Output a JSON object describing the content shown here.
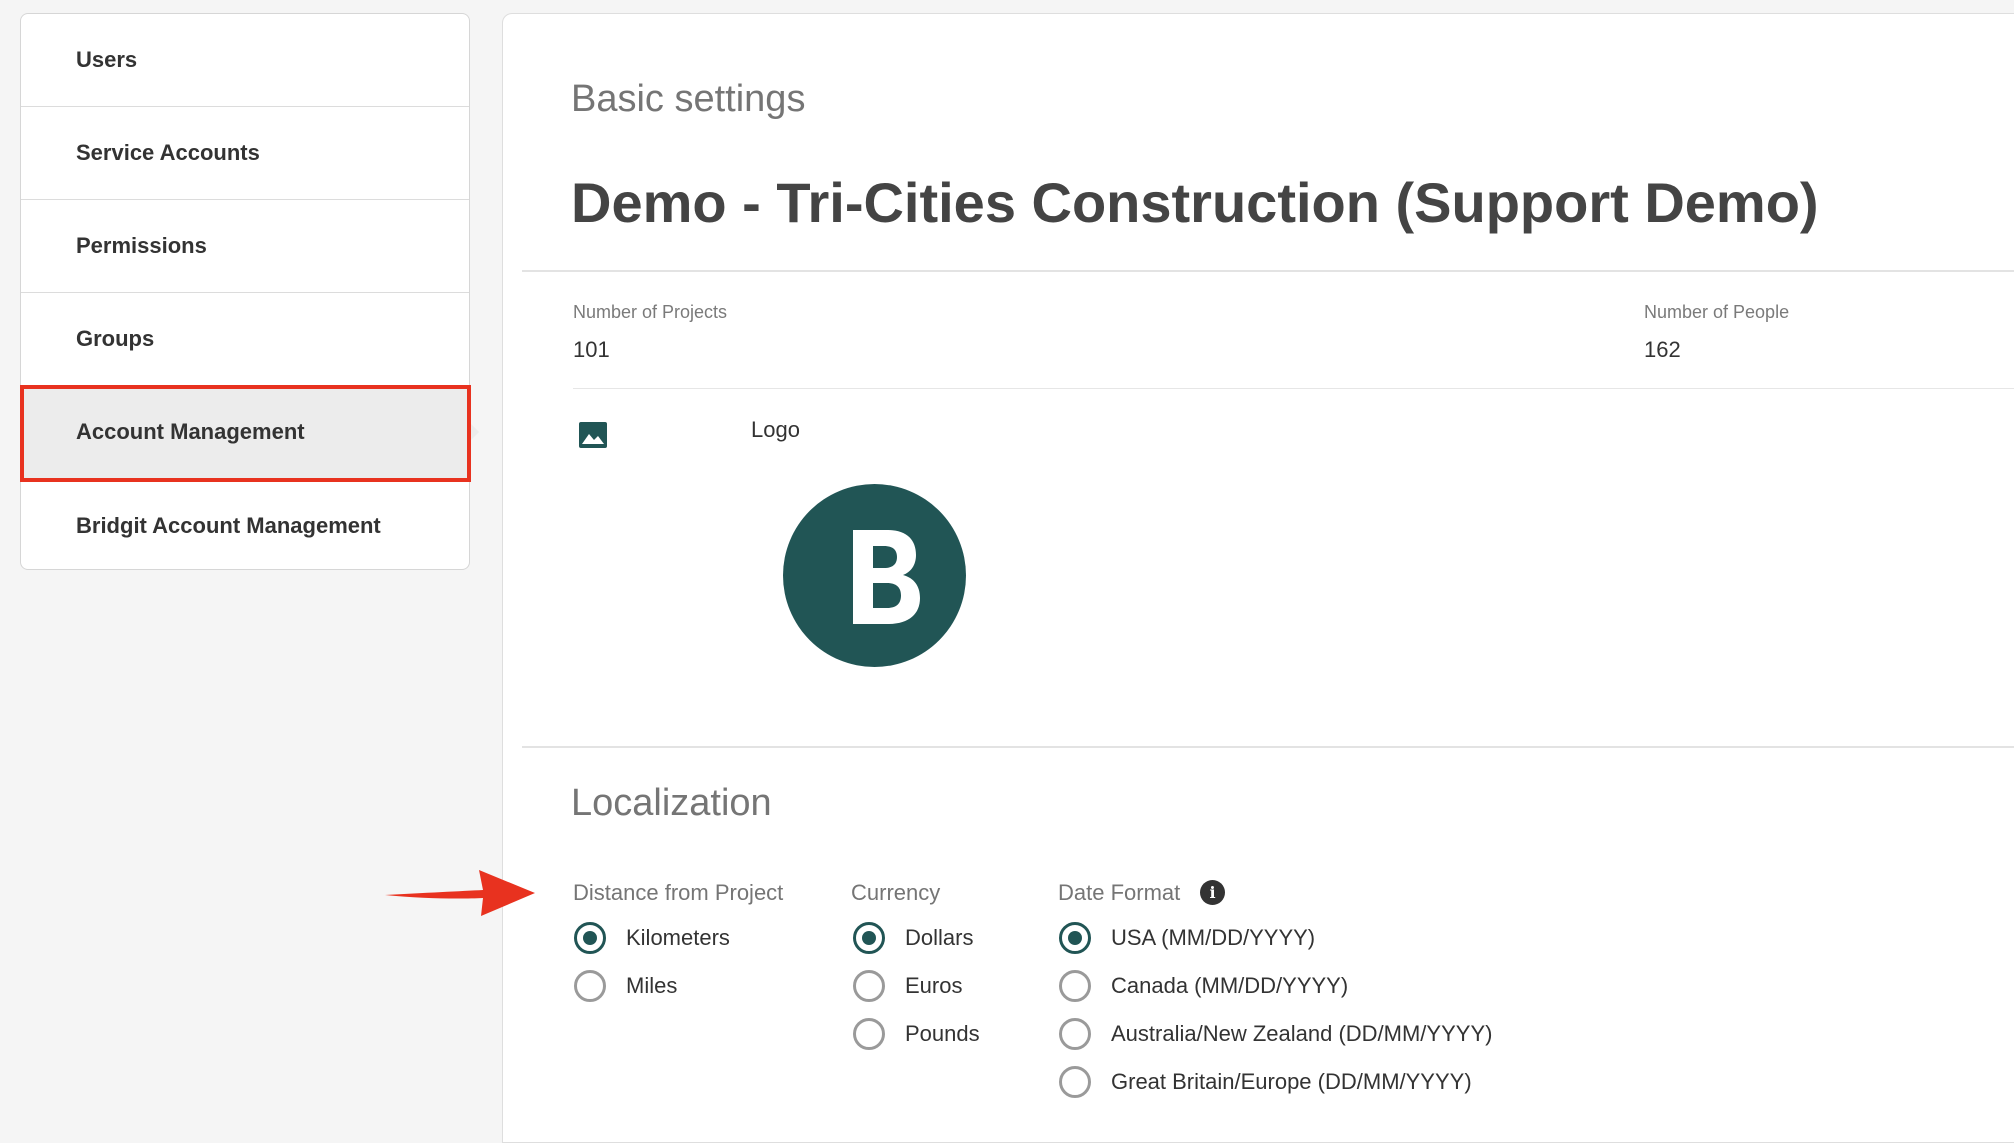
{
  "sidebar": {
    "items": [
      {
        "label": "Users"
      },
      {
        "label": "Service Accounts"
      },
      {
        "label": "Permissions"
      },
      {
        "label": "Groups"
      },
      {
        "label": "Account Management"
      },
      {
        "label": "Bridgit Account Management"
      }
    ],
    "active": "Account Management"
  },
  "basic": {
    "heading": "Basic settings",
    "account_name": "Demo - Tri-Cities Construction (Support Demo)",
    "projects_label": "Number of Projects",
    "projects_value": "101",
    "people_label": "Number of People",
    "people_value": "162",
    "logo_label": "Logo",
    "logo_letter": "B"
  },
  "localization": {
    "heading": "Localization",
    "distance": {
      "title": "Distance from Project",
      "options": [
        "Kilometers",
        "Miles"
      ],
      "selected": "Kilometers"
    },
    "currency": {
      "title": "Currency",
      "options": [
        "Dollars",
        "Euros",
        "Pounds"
      ],
      "selected": "Dollars"
    },
    "date_format": {
      "title": "Date Format",
      "info_glyph": "i",
      "options": [
        "USA (MM/DD/YYYY)",
        "Canada (MM/DD/YYYY)",
        "Australia/New Zealand (DD/MM/YYYY)",
        "Great Britain/Europe (DD/MM/YYYY)"
      ],
      "selected": "USA (MM/DD/YYYY)"
    }
  },
  "colors": {
    "brand": "#215555",
    "annotation": "#e8321f"
  }
}
